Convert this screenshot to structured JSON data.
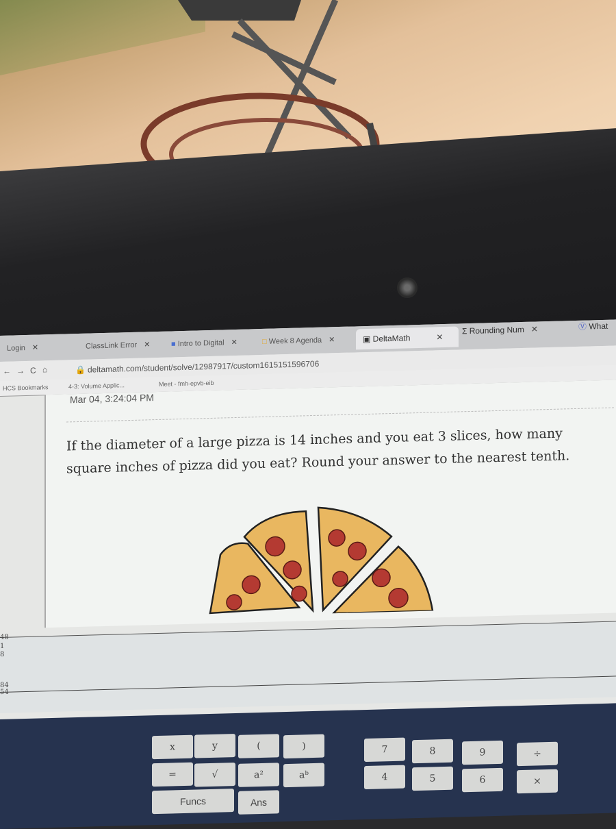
{
  "browser": {
    "tabs": [
      {
        "label": "Login"
      },
      {
        "label": "ClassLink Error"
      },
      {
        "label": "Intro to Digital"
      },
      {
        "label": "Week 8 Agenda"
      },
      {
        "label": "DeltaMath",
        "active": true
      },
      {
        "label": "Rounding Num"
      },
      {
        "label": "What"
      }
    ],
    "url": "deltamath.com/student/solve/12987917/custom1615151596706",
    "bookmarks": [
      {
        "label": "HCS Bookmarks"
      },
      {
        "label": "4-3: Volume Applic..."
      },
      {
        "label": "Meet - fmh-epvb-eib"
      }
    ]
  },
  "problem": {
    "timestamp": "Mar 04, 3:24:04 PM",
    "question": "If the diameter of a large pizza is 14 inches and you eat 3 slices, how many square inches of pizza did you eat? Round your answer to the nearest tenth."
  },
  "left_edge": [
    "48",
    "1",
    "8",
    "84",
    "54"
  ],
  "keypad": {
    "left": [
      "x",
      "y",
      "(",
      ")",
      "=",
      "√",
      "a²",
      "aᵇ",
      "Funcs",
      "Ans"
    ],
    "numbers": [
      "7",
      "8",
      "9",
      "÷",
      "4",
      "5",
      "6",
      "×"
    ]
  },
  "colors": {
    "keypad_bg": "#26334f",
    "key_bg": "#d7d8d6",
    "pizza_crust": "#e9b760",
    "pepperoni": "#b43a32"
  }
}
